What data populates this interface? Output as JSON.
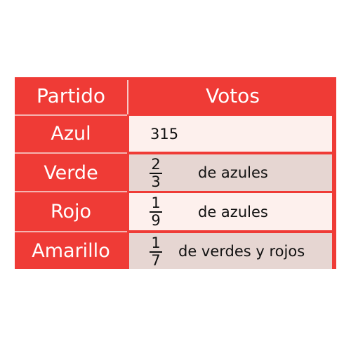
{
  "header": {
    "party_label": "Partido",
    "votes_label": "Votos"
  },
  "rows": [
    {
      "party": "Azul",
      "value": "315"
    },
    {
      "party": "Verde",
      "numerator": "2",
      "denominator": "3",
      "text": "de azules"
    },
    {
      "party": "Rojo",
      "numerator": "1",
      "denominator": "9",
      "text": "de azules"
    },
    {
      "party": "Amarillo",
      "numerator": "1",
      "denominator": "7",
      "text": "de verdes y rojos"
    }
  ],
  "colors": {
    "header_red": "#ef3b36",
    "row_light": "#fdf0ed",
    "row_dark": "#e6d6d2",
    "text_white": "#ffffff",
    "text_dark": "#111111"
  }
}
